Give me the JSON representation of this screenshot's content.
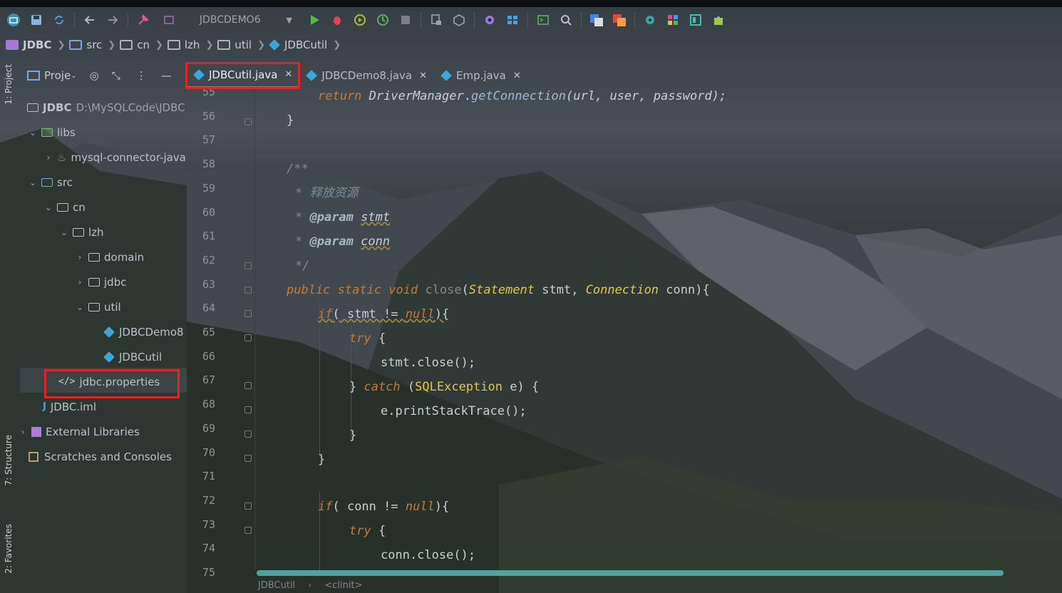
{
  "toolbar": {
    "run_config": "JDBCDEMO6",
    "icons": [
      "open-icon",
      "save-icon",
      "sync-icon",
      "back-icon",
      "forward-icon",
      "build-icon",
      "run-icon",
      "debug-icon",
      "coverage-icon",
      "profile-icon",
      "stop-icon",
      "attach-icon",
      "project-structure-icon",
      "settings-icon",
      "sdk-icon",
      "terminal-icon",
      "search-icon",
      "translate-icon",
      "translate2-icon",
      "plugin-icon"
    ]
  },
  "breadcrumb": {
    "items": [
      "JDBC",
      "src",
      "cn",
      "lzh",
      "util",
      "JDBCutil"
    ]
  },
  "side_tabs": {
    "project": "1: Project",
    "structure": "7: Structure",
    "favorites": "2: Favorites"
  },
  "project_panel": {
    "title": "Proje",
    "tree": [
      {
        "label": "JDBC",
        "extra": "D:\\MySQLCode\\JDBC"
      },
      {
        "label": "libs"
      },
      {
        "label": "mysql-connector-java"
      },
      {
        "label": "src"
      },
      {
        "label": "cn"
      },
      {
        "label": "lzh"
      },
      {
        "label": "domain"
      },
      {
        "label": "jdbc"
      },
      {
        "label": "util"
      },
      {
        "label": "JDBCDemo8"
      },
      {
        "label": "JDBCutil"
      },
      {
        "label": "jdbc.properties"
      },
      {
        "label": "JDBC.iml"
      },
      {
        "label": "External Libraries"
      },
      {
        "label": "Scratches and Consoles"
      }
    ]
  },
  "tabs": [
    {
      "label": "JDBCutil.java",
      "active": true
    },
    {
      "label": "JDBCDemo8.java",
      "active": false
    },
    {
      "label": "Emp.java",
      "active": false
    }
  ],
  "editor": {
    "line_numbers": [
      "55",
      "56",
      "57",
      "58",
      "59",
      "60",
      "61",
      "62",
      "63",
      "64",
      "65",
      "66",
      "67",
      "68",
      "69",
      "70",
      "71",
      "72",
      "73",
      "74",
      "75"
    ],
    "lines": {
      "l55": [
        "return ",
        "DriverManager",
        ".",
        "getConnection",
        "(url, user, password);"
      ],
      "l56": "}",
      "l58": "/**",
      "l59": "* 释放资源",
      "l60a": "* ",
      "l60b": "@param",
      "l60c": "stmt",
      "l61a": "* ",
      "l61b": "@param",
      "l61c": "conn",
      "l62": "*/",
      "l63": [
        "public static void ",
        "close",
        "(",
        "Statement",
        " stmt, ",
        "Connection",
        " conn){"
      ],
      "l64": [
        "if",
        " stmt != ",
        "null",
        "){"
      ],
      "l65": [
        "try",
        " {"
      ],
      "l66": "stmt.close();",
      "l67": [
        "} ",
        "catch",
        " (",
        "SQLException",
        " e) {"
      ],
      "l68": "e.printStackTrace();",
      "l69": "}",
      "l70": "}",
      "l72": [
        "if",
        "( conn != ",
        "null",
        "){"
      ],
      "l73": [
        "try",
        " {"
      ],
      "l74": "conn.close();"
    }
  },
  "status_bar": {
    "class": "JDBCutil",
    "member": "<clinit>"
  }
}
